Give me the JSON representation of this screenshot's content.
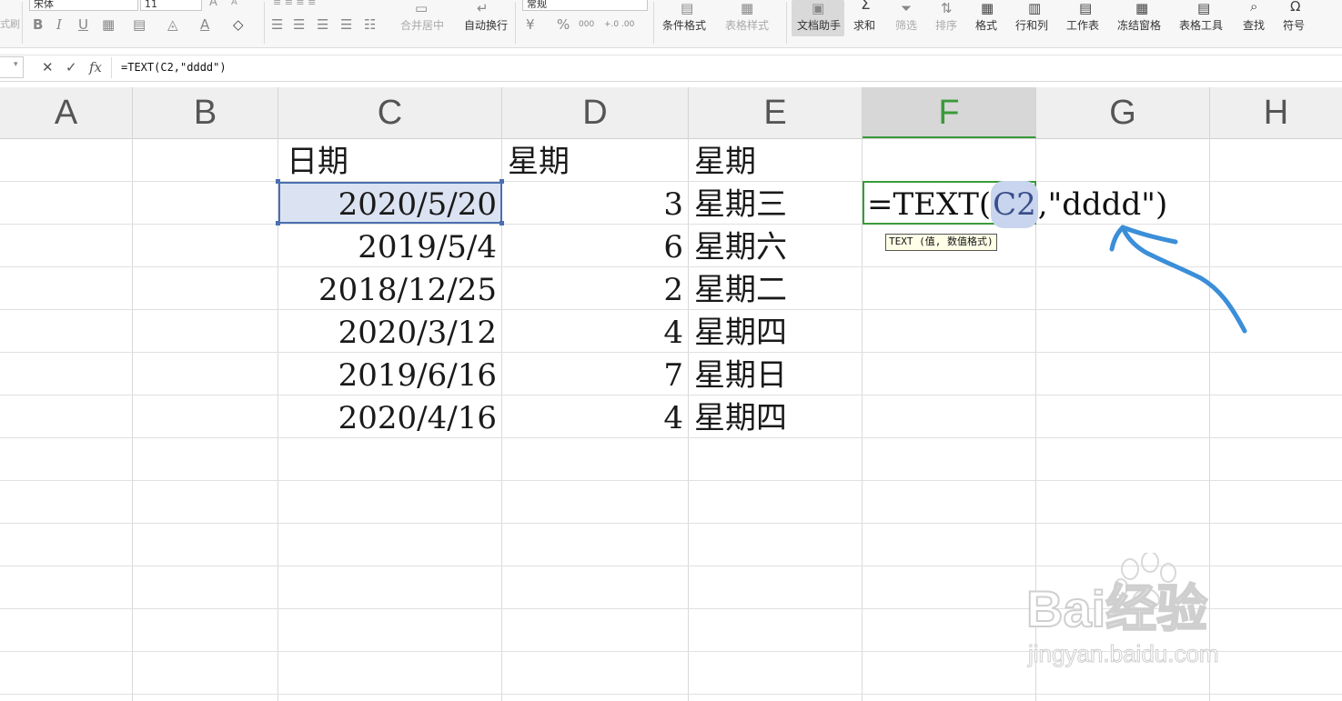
{
  "toolbar": {
    "font_name": "宋体",
    "font_size": "11",
    "number_format": "常规",
    "merge_center": "合并居中",
    "wrap_text": "自动换行",
    "conditional_format": "条件格式",
    "table_style": "表格样式",
    "doc_assistant": "文档助手",
    "sum": "求和",
    "filter": "筛选",
    "sort": "排序",
    "format": "格式",
    "row_col": "行和列",
    "worksheet": "工作表",
    "freeze_panes": "冻结窗格",
    "table_tools": "表格工具",
    "find": "查找",
    "symbol": "符号",
    "left_edge_label": "式刷",
    "icons": [
      "bold-icon",
      "italic-icon",
      "underline-icon",
      "border-icon",
      "fill-color-icon",
      "font-color-icon",
      "eraser-icon",
      "align-icons",
      "currency-icon",
      "percent-icon",
      "thousands-icon",
      "decimal-icons",
      "sum-icon",
      "sort-icon",
      "find-icon",
      "symbol-icon"
    ],
    "glyphs": {
      "bold": "B",
      "italic": "I",
      "underline": "U",
      "percent": "%",
      "thousands": "000",
      "decimal": "+.0 .00",
      "sum": "Σ",
      "font_a": "A",
      "chev": "▾"
    }
  },
  "formula_bar": {
    "cancel_icon": "✕",
    "confirm_icon": "✓",
    "fx_label": "fx",
    "formula": "=TEXT(C2,\"dddd\")"
  },
  "columns": [
    "A",
    "B",
    "C",
    "D",
    "E",
    "F",
    "G",
    "H"
  ],
  "active_column": "F",
  "rows": [
    {
      "c": "日期",
      "d": "星期",
      "e": "星期"
    },
    {
      "c": "2020/5/20",
      "d": "3",
      "e": "星期三"
    },
    {
      "c": "2019/5/4",
      "d": "6",
      "e": "星期六"
    },
    {
      "c": "2018/12/25",
      "d": "2",
      "e": "星期二"
    },
    {
      "c": "2020/3/12",
      "d": "4",
      "e": "星期四"
    },
    {
      "c": "2019/6/16",
      "d": "7",
      "e": "星期日"
    },
    {
      "c": "2020/4/16",
      "d": "4",
      "e": "星期四"
    }
  ],
  "editing_cell": {
    "prefix": "=TEXT(",
    "ref": "C2",
    "suffix": ",\"dddd\")",
    "tooltip": "TEXT (值, 数值格式)"
  },
  "annotation": {
    "color": "#3b8ed8"
  },
  "watermark": {
    "logo": "Bai经验",
    "url": "jingyan.baidu.com"
  },
  "colors": {
    "active_column": "#3a9a3a",
    "selection": "#4b6fb0"
  }
}
